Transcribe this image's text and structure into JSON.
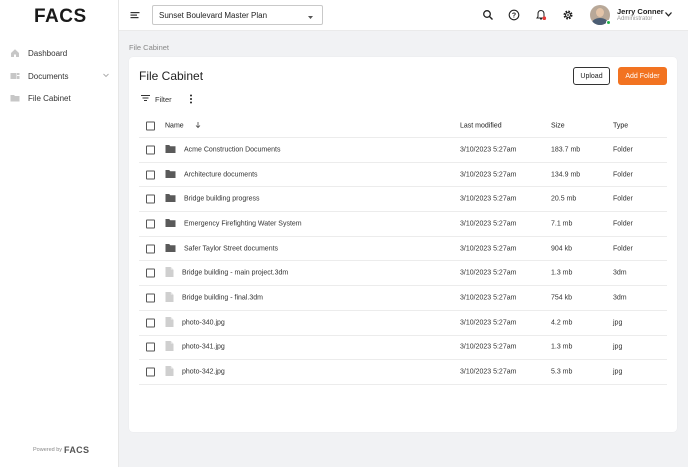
{
  "brand": {
    "logo": "FACS",
    "powered_by": "Powered by",
    "powered_logo": "FACS"
  },
  "sidebar": {
    "items": [
      {
        "label": "Dashboard",
        "icon": "home-icon"
      },
      {
        "label": "Documents",
        "icon": "documents-icon",
        "expandable": true
      },
      {
        "label": "File Cabinet",
        "icon": "folder-icon"
      }
    ]
  },
  "topbar": {
    "project": "Sunset Boulevard Master Plan",
    "icons": [
      "search-icon",
      "help-icon",
      "notifications-icon",
      "settings-icon"
    ],
    "user": {
      "name": "Jerry Conner",
      "role": "Administrator"
    }
  },
  "breadcrumb": "File Cabinet",
  "page": {
    "title": "File Cabinet",
    "upload_label": "Upload",
    "add_folder_label": "Add Folder",
    "filter_label": "Filter"
  },
  "table": {
    "columns": {
      "name": "Name",
      "modified": "Last modified",
      "size": "Size",
      "type": "Type"
    },
    "rows": [
      {
        "name": "Acme Construction Documents",
        "modified": "3/10/2023 5:27am",
        "size": "183.7 mb",
        "type": "Folder",
        "kind": "folder"
      },
      {
        "name": "Architecture documents",
        "modified": "3/10/2023 5:27am",
        "size": "134.9 mb",
        "type": "Folder",
        "kind": "folder"
      },
      {
        "name": "Bridge building progress",
        "modified": "3/10/2023 5:27am",
        "size": "20.5 mb",
        "type": "Folder",
        "kind": "folder"
      },
      {
        "name": "Emergency Firefighting Water System",
        "modified": "3/10/2023 5:27am",
        "size": "7.1 mb",
        "type": "Folder",
        "kind": "folder"
      },
      {
        "name": "Safer Taylor Street documents",
        "modified": "3/10/2023 5:27am",
        "size": "904 kb",
        "type": "Folder",
        "kind": "folder"
      },
      {
        "name": "Bridge building - main project.3dm",
        "modified": "3/10/2023 5:27am",
        "size": "1.3 mb",
        "type": "3dm",
        "kind": "file"
      },
      {
        "name": "Bridge building - final.3dm",
        "modified": "3/10/2023 5:27am",
        "size": "754 kb",
        "type": "3dm",
        "kind": "file"
      },
      {
        "name": "photo-340.jpg",
        "modified": "3/10/2023 5:27am",
        "size": "4.2 mb",
        "type": "jpg",
        "kind": "file"
      },
      {
        "name": "photo-341.jpg",
        "modified": "3/10/2023 5:27am",
        "size": "1.3 mb",
        "type": "jpg",
        "kind": "file"
      },
      {
        "name": "photo-342.jpg",
        "modified": "3/10/2023 5:27am",
        "size": "5.3 mb",
        "type": "jpg",
        "kind": "file"
      }
    ]
  },
  "colors": {
    "accent": "#f27321",
    "status_online": "#22b14c",
    "notification_dot": "#e53935"
  }
}
